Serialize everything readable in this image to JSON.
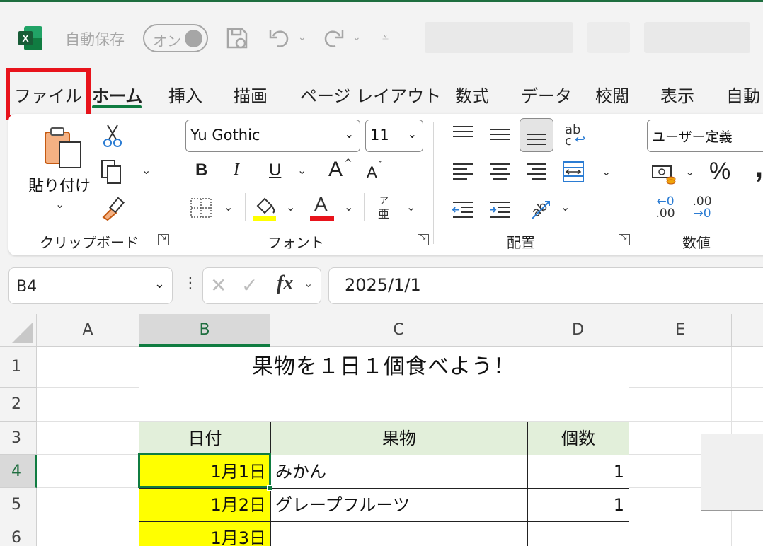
{
  "titlebar": {
    "autosave_label": "自動保存",
    "toggle_label": "オン"
  },
  "tabs": [
    {
      "label": "ファイル"
    },
    {
      "label": "ホーム"
    },
    {
      "label": "挿入"
    },
    {
      "label": "描画"
    },
    {
      "label": "ページ レイアウト"
    },
    {
      "label": "数式"
    },
    {
      "label": "データ"
    },
    {
      "label": "校閲"
    },
    {
      "label": "表示"
    },
    {
      "label": "自動"
    }
  ],
  "ribbon": {
    "clipboard": {
      "paste_label": "貼り付け",
      "group_label": "クリップボード"
    },
    "font": {
      "font_name": "Yu Gothic",
      "font_size": "11",
      "bold": "B",
      "italic": "I",
      "underline": "U",
      "grow": "A",
      "shrink": "A",
      "font_color_letter": "A",
      "furigana_top": "ア",
      "furigana_bottom": "亜",
      "group_label": "フォント",
      "highlight_color": "#ffff00",
      "font_color": "#e8131b"
    },
    "alignment": {
      "wrap_top": "ab",
      "wrap_bottom": "c",
      "group_label": "配置"
    },
    "number": {
      "format": "ユーザー定義",
      "percent": "%",
      "comma": ",",
      "inc_decimal_top": "←0",
      "inc_decimal_bottom": ".00",
      "dec_decimal_top": ".00",
      "dec_decimal_bottom": "→0",
      "group_label": "数値"
    }
  },
  "formula_bar": {
    "name_box": "B4",
    "fx": "fx",
    "content": "2025/1/1"
  },
  "grid": {
    "columns": [
      "A",
      "B",
      "C",
      "D",
      "E"
    ],
    "rows": [
      "1",
      "2",
      "3",
      "4",
      "5",
      "6"
    ],
    "title": "果物を１日１個食べよう！",
    "headers": [
      "日付",
      "果物",
      "個数"
    ],
    "data": [
      {
        "date": "1月1日",
        "fruit": "みかん",
        "count": "1"
      },
      {
        "date": "1月2日",
        "fruit": "グレープフルーツ",
        "count": "1"
      },
      {
        "date": "1月3日",
        "fruit": "",
        "count": ""
      }
    ]
  }
}
